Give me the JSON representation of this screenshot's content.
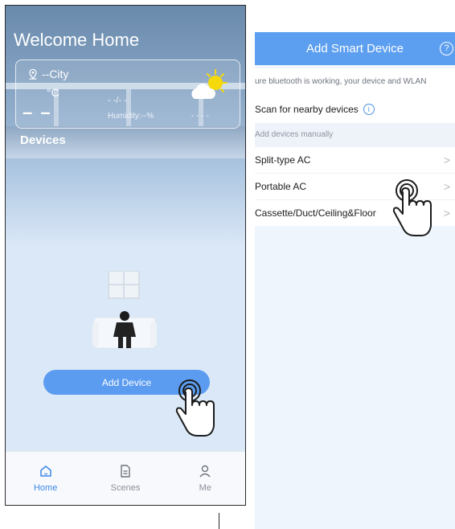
{
  "left": {
    "title": "Welcome Home",
    "weather": {
      "city": "--City",
      "temp_unit": "°C",
      "temp_value": "– –",
      "time": "- -/- -",
      "humidity": "Humidity:--%",
      "condition_dash": "- - - -"
    },
    "devices_label": "Devices",
    "add_button": "Add Device",
    "tabs": [
      {
        "label": "Home",
        "icon": "home-icon",
        "active": true
      },
      {
        "label": "Scenes",
        "icon": "scenes-icon",
        "active": false
      },
      {
        "label": "Me",
        "icon": "user-icon",
        "active": false
      }
    ]
  },
  "right": {
    "header_title": "Add Smart Device",
    "help_glyph": "?",
    "notice": "ure bluetooth is working, your device and WLAN",
    "scan_label": "Scan for nearby devices",
    "info_glyph": "i",
    "manual_header": "Add devices manually",
    "items": [
      {
        "label": "Split-type AC"
      },
      {
        "label": "Portable AC"
      },
      {
        "label": "Cassette/Duct/Ceiling&Floor"
      }
    ],
    "chevron": ">"
  },
  "colors": {
    "accent": "#5c9ef0",
    "active_tab": "#3d88e8",
    "sun": "#f5d90a"
  }
}
